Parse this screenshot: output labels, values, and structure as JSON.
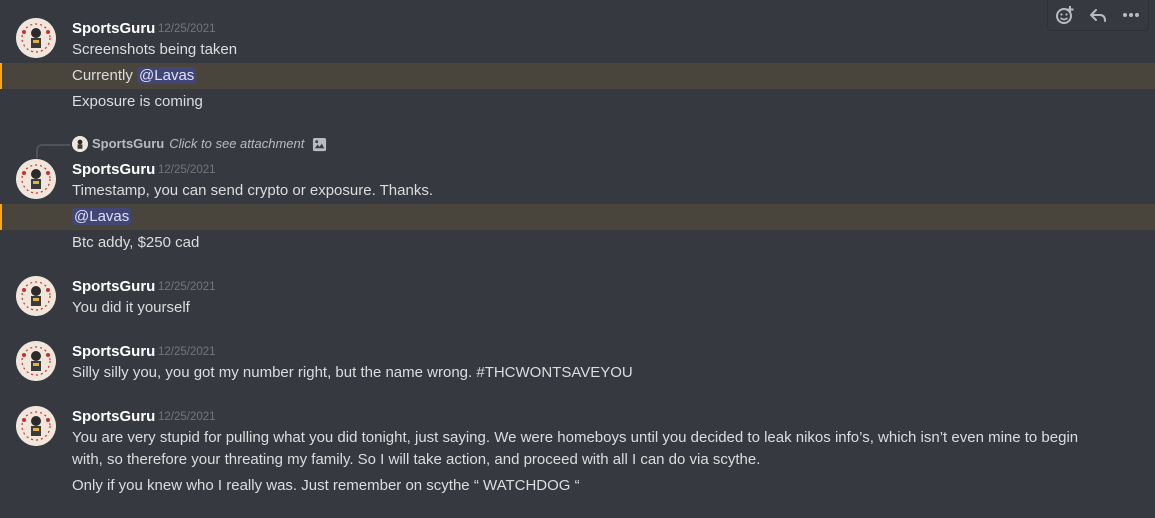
{
  "toolbar": {
    "add_reaction_icon": "add-reaction-icon",
    "reply_icon": "reply-icon",
    "more_icon": "more-icon"
  },
  "groups": [
    {
      "author": "SportsGuru",
      "timestamp": "12/25/2021",
      "lines": [
        {
          "text": "Screenshots being taken"
        },
        {
          "text": "Currently ",
          "mention": "@Lavas"
        },
        {
          "text": "Exposure is coming"
        }
      ]
    },
    {
      "reply": {
        "author": "SportsGuru",
        "text": "Click to see attachment"
      },
      "author": "SportsGuru",
      "timestamp": "12/25/2021",
      "lines": [
        {
          "text": "Timestamp, you can send crypto or exposure. Thanks."
        },
        {
          "mention": "@Lavas"
        },
        {
          "text": "Btc addy, $250 cad"
        }
      ]
    },
    {
      "author": "SportsGuru",
      "timestamp": "12/25/2021",
      "lines": [
        {
          "text": "You did it yourself"
        }
      ]
    },
    {
      "author": "SportsGuru",
      "timestamp": "12/25/2021",
      "lines": [
        {
          "text": "Silly silly you, you got my number right, but the name wrong. #THCWONTSAVEYOU"
        }
      ]
    },
    {
      "author": "SportsGuru",
      "timestamp": "12/25/2021",
      "lines": [
        {
          "text": "You are very stupid for pulling what you did tonight, just saying. We were homeboys until you decided to leak nikos info’s, which isn’t even mine to begin with, so therefore your threating my family. So I will take action, and proceed with all I can do via scythe."
        },
        {
          "text": "Only if you knew who I really was. Just remember on scythe “ WATCHDOG “"
        }
      ]
    }
  ],
  "colors": {
    "background": "#36393f",
    "mention_highlight": "#49443c",
    "mention_bar": "#faa81a",
    "mention_pill": "#414675"
  }
}
